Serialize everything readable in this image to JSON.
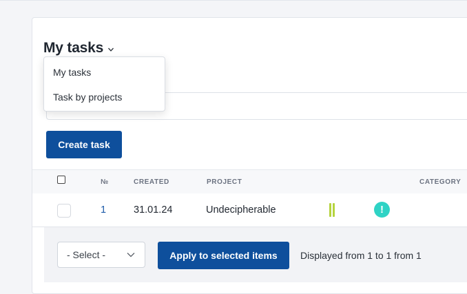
{
  "header": {
    "title": "My tasks",
    "chevron_icon": "chevron-down-icon"
  },
  "dropdown": {
    "items": [
      {
        "label": "My tasks"
      },
      {
        "label": "Task by projects"
      }
    ]
  },
  "toolbar": {
    "create_label": "Create task"
  },
  "table": {
    "columns": {
      "number": "№",
      "created": "CREATED",
      "project": "PROJECT",
      "category": "CATEGORY"
    },
    "rows": [
      {
        "number": "1",
        "created": "31.01.24",
        "project": "Undecipherable",
        "priority_icon": "priority-bars-icon",
        "status_icon": "exclamation-circle-icon",
        "status_glyph": "!"
      }
    ]
  },
  "bulk": {
    "select_value": "- Select -",
    "apply_label": "Apply to selected items",
    "displayed_text": "Displayed from 1 to 1 from 1"
  },
  "colors": {
    "primary": "#0e4f9c",
    "link": "#1c5aa8",
    "priority": "#b5d33d",
    "status": "#2fd3c5"
  }
}
